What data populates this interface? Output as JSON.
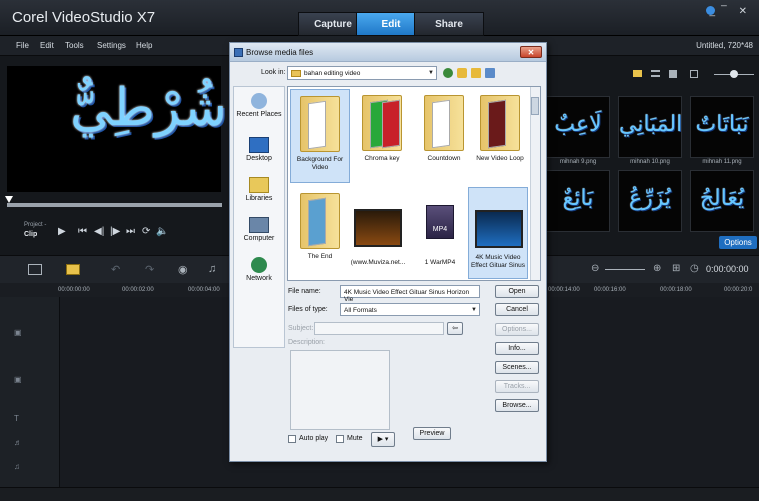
{
  "app": {
    "title": "Corel VideoStudio X7",
    "tabs": [
      "Capture",
      "Edit",
      "Share"
    ],
    "active_tab": "Edit",
    "window_buttons": "_ ̅ ✕",
    "project_info": "Untitled, 720*48"
  },
  "menu": [
    "File",
    "Edit",
    "Tools",
    "Settings",
    "Help"
  ],
  "preview": {
    "overlay_text": "شُرْطِيٌّ",
    "project_label": "Project -",
    "clip_label": "Clip"
  },
  "library": {
    "thumbs": [
      {
        "art": "لَاعِبٌ",
        "caption": "mihnah 9.png"
      },
      {
        "art": "المَبَانِي",
        "caption": "mihnah 10.png"
      },
      {
        "art": "نَبَاتَاتٌ",
        "caption": "mihnah 11.png"
      },
      {
        "art": "بَائِعٌ",
        "caption": ""
      },
      {
        "art": "يُزَرِّعُ",
        "caption": ""
      },
      {
        "art": "يُعَالِجُ",
        "caption": ""
      }
    ],
    "options_label": "Options"
  },
  "timeline": {
    "ruler": [
      "00:00:00:00",
      "00:00:02:00",
      "00:00:04:00",
      "00:00:14:00",
      "00:00:16:00",
      "00:00:18:00",
      "00:00:20:0"
    ],
    "time_display": "0:00:00:00"
  },
  "dialog": {
    "title": "Browse media files",
    "look_in_label": "Look in:",
    "look_in_value": "bahan editing video",
    "places": [
      "Recent Places",
      "Desktop",
      "Libraries",
      "Computer",
      "Network"
    ],
    "files": [
      {
        "label": "Background For Video",
        "kind": "folder",
        "selected": true
      },
      {
        "label": "Chroma key",
        "kind": "folder",
        "selected": false
      },
      {
        "label": "Countdown",
        "kind": "folder",
        "selected": false
      },
      {
        "label": "New Video Loop",
        "kind": "folder",
        "selected": false
      },
      {
        "label": "The End",
        "kind": "folder",
        "selected": false
      },
      {
        "label": "(www.Muviza.net...",
        "kind": "video",
        "selected": false
      },
      {
        "label": "1 WarMP4",
        "kind": "mp4",
        "selected": false
      },
      {
        "label": "4K Music Video Effect Gituar Sinus",
        "kind": "video",
        "selected": true
      }
    ],
    "mp4_badge": "MP4",
    "file_name_label": "File name:",
    "file_name_value": "4K Music Video Effect Gituar Sinus Horizon Vie",
    "file_type_label": "Files of type:",
    "file_type_value": "All Formats",
    "subject_label": "Subject:",
    "description_label": "Description:",
    "buttons": {
      "open": "Open",
      "cancel": "Cancel",
      "options": "Options...",
      "info": "Info...",
      "scenes": "Scenes...",
      "tracks": "Tracks...",
      "browse": "Browse...",
      "preview": "Preview"
    },
    "auto_play_label": "Auto play",
    "mute_label": "Mute"
  },
  "colors": {
    "accent": "#2a8ce0",
    "dialog_bg": "#e9edf2",
    "arabic_text": "#7fd2ff"
  }
}
